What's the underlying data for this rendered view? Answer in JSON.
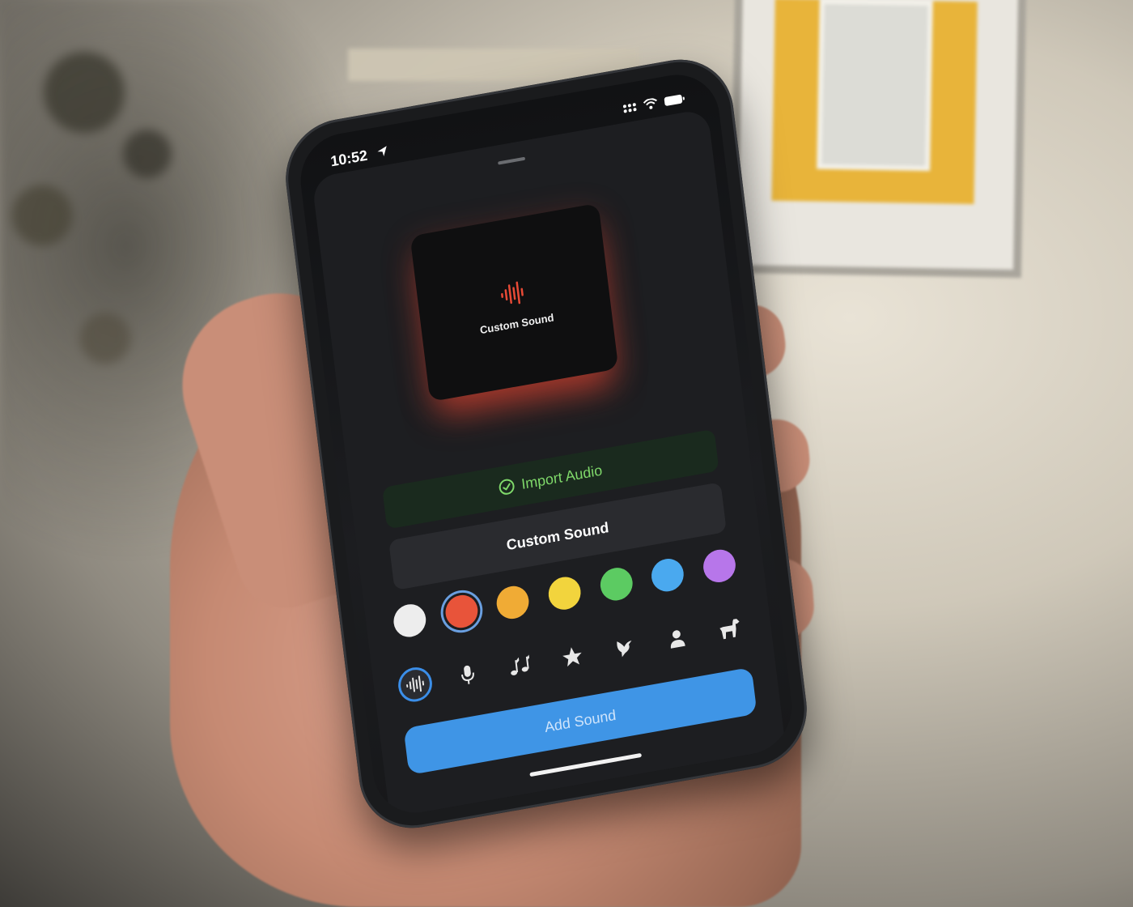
{
  "status_bar": {
    "time": "10:52"
  },
  "preview": {
    "title": "Custom Sound",
    "icon": "waveform-icon",
    "accent": "#e84a36"
  },
  "import_button": {
    "label": "Import Audio",
    "icon": "checkmark-circle-icon",
    "color": "#7fd96a"
  },
  "name_field": {
    "value": "Custom Sound"
  },
  "colors": [
    {
      "name": "white",
      "hex": "#ededed",
      "selected": false
    },
    {
      "name": "red",
      "hex": "#e8543a",
      "selected": true
    },
    {
      "name": "orange",
      "hex": "#f0ab35",
      "selected": false
    },
    {
      "name": "yellow",
      "hex": "#f2d43d",
      "selected": false
    },
    {
      "name": "green",
      "hex": "#5ccb62",
      "selected": false
    },
    {
      "name": "blue",
      "hex": "#4aa9ef",
      "selected": false
    },
    {
      "name": "purple",
      "hex": "#b776ea",
      "selected": false
    }
  ],
  "icons": [
    {
      "name": "waveform-icon",
      "glyph": "",
      "selected": true
    },
    {
      "name": "microphone-icon",
      "glyph": "🎙",
      "selected": false
    },
    {
      "name": "music-notes-icon",
      "glyph": "♫",
      "selected": false
    },
    {
      "name": "star-icon",
      "glyph": "★",
      "selected": false
    },
    {
      "name": "bird-icon",
      "glyph": "🕊",
      "selected": false
    },
    {
      "name": "person-icon",
      "glyph": "👤",
      "selected": false
    },
    {
      "name": "dog-icon",
      "glyph": "🐕",
      "selected": false
    }
  ],
  "add_button": {
    "label": "Add Sound",
    "color": "#3f95e6"
  }
}
